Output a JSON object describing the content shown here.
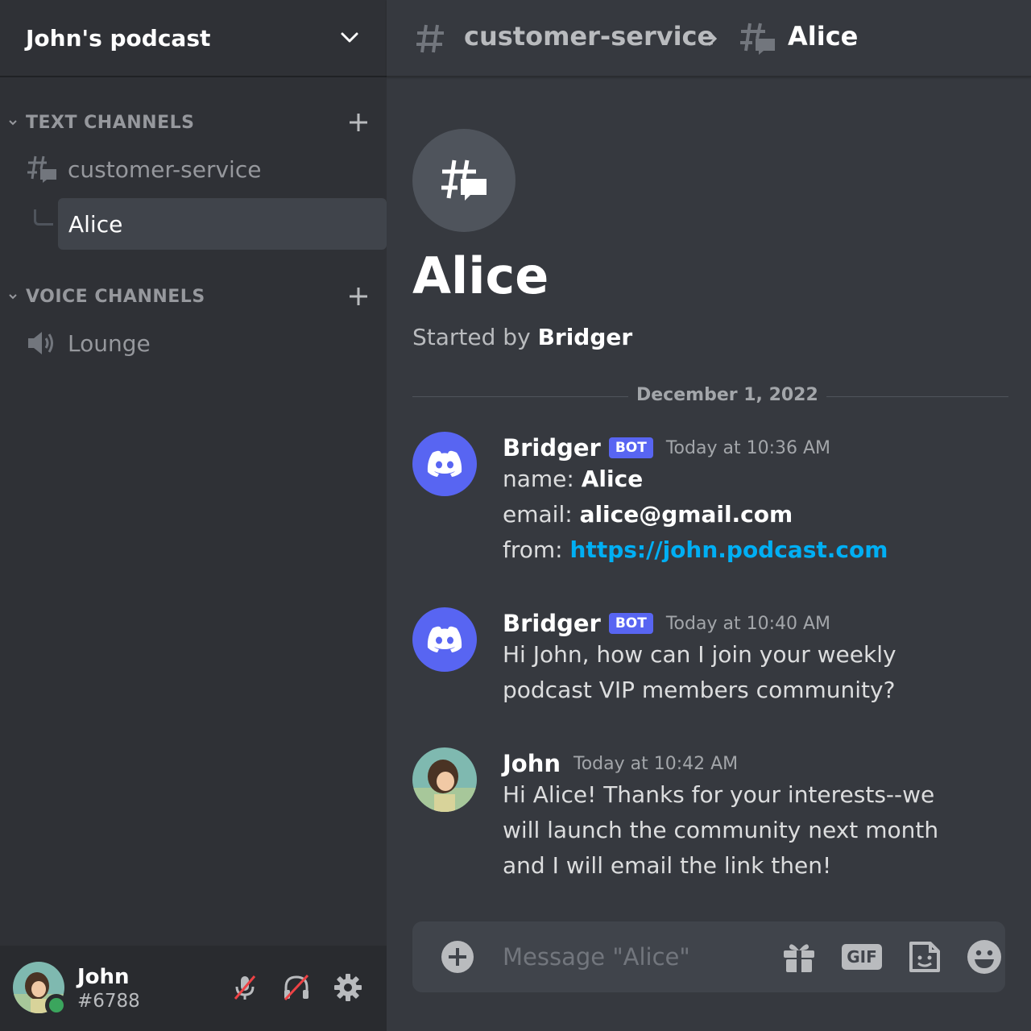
{
  "server": {
    "name": "John's podcast"
  },
  "sidebar": {
    "text_category": "TEXT CHANNELS",
    "voice_category": "VOICE CHANNELS",
    "text_channels": [
      {
        "name": "customer-service"
      }
    ],
    "thread": {
      "name": "Alice"
    },
    "voice_channels": [
      {
        "name": "Lounge"
      }
    ]
  },
  "user": {
    "name": "John",
    "tag": "#6788",
    "status": "online"
  },
  "topbar": {
    "channel": "customer-service",
    "thread": "Alice"
  },
  "thread_header": {
    "title": "Alice",
    "started_by_prefix": "Started by",
    "started_by_name": "Bridger"
  },
  "date_divider": "December 1, 2022",
  "messages": [
    {
      "author": "Bridger",
      "bot_tag": "BOT",
      "time": "Today at 10:36 AM",
      "fields": [
        {
          "label": "name:",
          "value": "Alice"
        },
        {
          "label": "email:",
          "value": "alice@gmail.com"
        },
        {
          "label": "from:",
          "value": "https://john.podcast.com"
        }
      ]
    },
    {
      "author": "Bridger",
      "bot_tag": "BOT",
      "time": "Today at 10:40 AM",
      "lines": [
        "Hi John, how can I join your weekly",
        "podcast VIP members community?"
      ]
    },
    {
      "author": "John",
      "time": "Today at 10:42 AM",
      "lines": [
        "Hi Alice! Thanks for your interests--we",
        "will launch the community next month",
        "and I will email the link then!"
      ]
    }
  ],
  "composer": {
    "placeholder": "Message \"Alice\"",
    "gif_label": "GIF"
  },
  "colors": {
    "accent": "#5865f2",
    "link": "#00aff4",
    "online": "#3ba55d",
    "muted_red": "#ed4245"
  }
}
